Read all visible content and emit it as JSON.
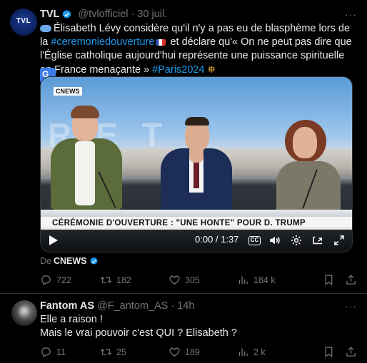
{
  "tweet1": {
    "name": "TVL",
    "handle": "@tvlofficiel",
    "time": "30 juil.",
    "more": "···",
    "text_part1": "Élisabeth Lévy considère qu'il n'y a pas eu de blasphème lors de la",
    "hashtag1": "#ceremoniedouverture",
    "text_part2": "et déclare qu'« On ne peut pas dire que l'Église catholique aujourd'hui représente une puissance spirituelle en France menaçante »",
    "hashtag2": "#Paris2024",
    "avatar_text": "TVL",
    "video": {
      "channel_logo": "CNEWS",
      "background_text": "RETE",
      "lower_third": "CÉRÉMONIE D'OUVERTURE : \"UNE HONTE\" POUR D. TRUMP",
      "time": "0:00 / 1:37",
      "cc_label": "CC"
    },
    "source_prefix": "De",
    "source_name": "CNEWS",
    "replies": "722",
    "reposts": "182",
    "likes": "305",
    "views": "184 k"
  },
  "tweet2": {
    "name": "Fantom AS",
    "handle": "@F_antom_AS",
    "time": "14h",
    "more": "···",
    "line1": "Elle a raison !",
    "line2": "Mais le vrai pouvoir c'est QUI ? Elisabeth ?",
    "replies": "11",
    "reposts": "25",
    "likes": "189",
    "views": "2 k"
  },
  "colors": {
    "background": "#000000",
    "text": "#e7e9ea",
    "muted": "#71767b",
    "link": "#1d9bf0",
    "divider": "#2f3336",
    "brand_red": "#e31d2b"
  },
  "icons": [
    "verified-badge-icon",
    "translate-icon",
    "play-icon",
    "captions-icon",
    "volume-icon",
    "settings-icon",
    "pip-icon",
    "fullscreen-icon",
    "reply-icon",
    "repost-icon",
    "like-icon",
    "views-icon",
    "bookmark-icon",
    "share-icon"
  ]
}
